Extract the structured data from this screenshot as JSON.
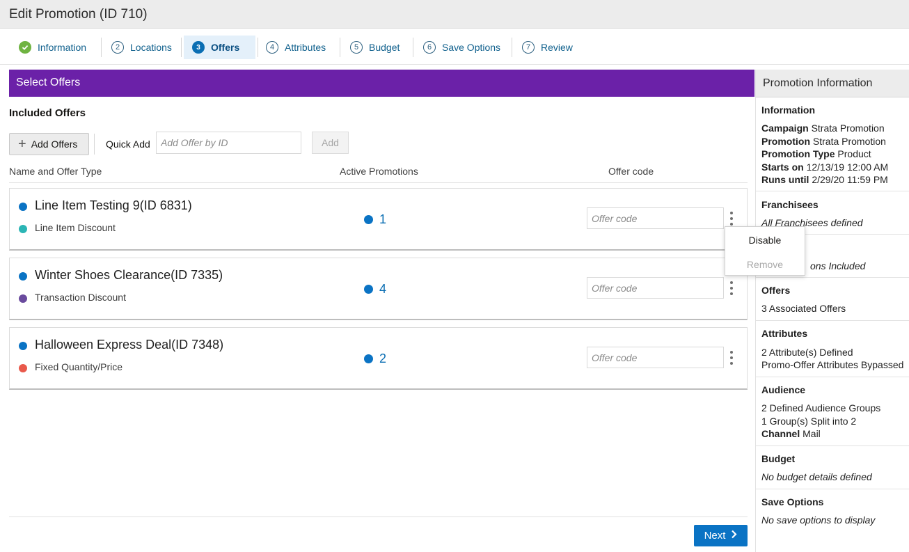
{
  "window": {
    "title": "Edit Promotion (ID 710)"
  },
  "steps": [
    {
      "label": "Information",
      "number": ""
    },
    {
      "label": "Locations",
      "number": "2"
    },
    {
      "label": "Offers",
      "number": "3"
    },
    {
      "label": "Attributes",
      "number": "4"
    },
    {
      "label": "Budget",
      "number": "5"
    },
    {
      "label": "Save Options",
      "number": "6"
    },
    {
      "label": "Review",
      "number": "7"
    }
  ],
  "colors": {
    "accent": "#6b21a8",
    "primary": "#0a73c4",
    "complete": "#6fb341"
  },
  "main": {
    "section_title": "Select Offers",
    "included_title": "Included Offers",
    "add_offers_label": "Add Offers",
    "quick_add_label": "Quick Add",
    "quick_add_placeholder": "Add Offer by ID",
    "add_label": "Add",
    "columns": {
      "name": "Name and Offer Type",
      "active": "Active Promotions",
      "code": "Offer code"
    },
    "offers": [
      {
        "name": "Line Item Testing 9(ID 6831)",
        "type": "Line Item Discount",
        "type_color": "#2bb5b5",
        "active": "1",
        "code_placeholder": "Offer code"
      },
      {
        "name": "Winter Shoes Clearance(ID 7335)",
        "type": "Transaction Discount",
        "type_color": "#6a4b9e",
        "active": "4",
        "code_placeholder": "Offer code"
      },
      {
        "name": "Halloween Express Deal(ID 7348)",
        "type": "Fixed Quantity/Price",
        "type_color": "#e9594b",
        "active": "2",
        "code_placeholder": "Offer code"
      }
    ],
    "menu": {
      "disable": "Disable",
      "remove": "Remove"
    },
    "next_label": "Next"
  },
  "side": {
    "title": "Promotion Information",
    "information": {
      "heading": "Information",
      "rows": [
        {
          "k": "Campaign",
          "v": "Strata Promotion"
        },
        {
          "k": "Promotion",
          "v": "Strata Promotion"
        },
        {
          "k": "Promotion Type",
          "v": "Product"
        },
        {
          "k": "Starts on",
          "v": "12/13/19 12:00 AM"
        },
        {
          "k": "Runs until",
          "v": "2/29/20 11:59 PM"
        }
      ]
    },
    "franchisees": {
      "heading": "Franchisees",
      "text": "All Franchisees defined"
    },
    "locations": {
      "text": "ons Included"
    },
    "offers": {
      "heading": "Offers",
      "text": "3 Associated Offers"
    },
    "attributes": {
      "heading": "Attributes",
      "line1": "2 Attribute(s) Defined",
      "line2": "Promo-Offer Attributes Bypassed"
    },
    "audience": {
      "heading": "Audience",
      "line1": "2 Defined Audience Groups",
      "line2": "1 Group(s) Split into 2",
      "channel_key": "Channel",
      "channel_value": "Mail"
    },
    "budget": {
      "heading": "Budget",
      "text": "No budget details defined"
    },
    "save_options": {
      "heading": "Save Options",
      "text": "No save options to display"
    }
  }
}
